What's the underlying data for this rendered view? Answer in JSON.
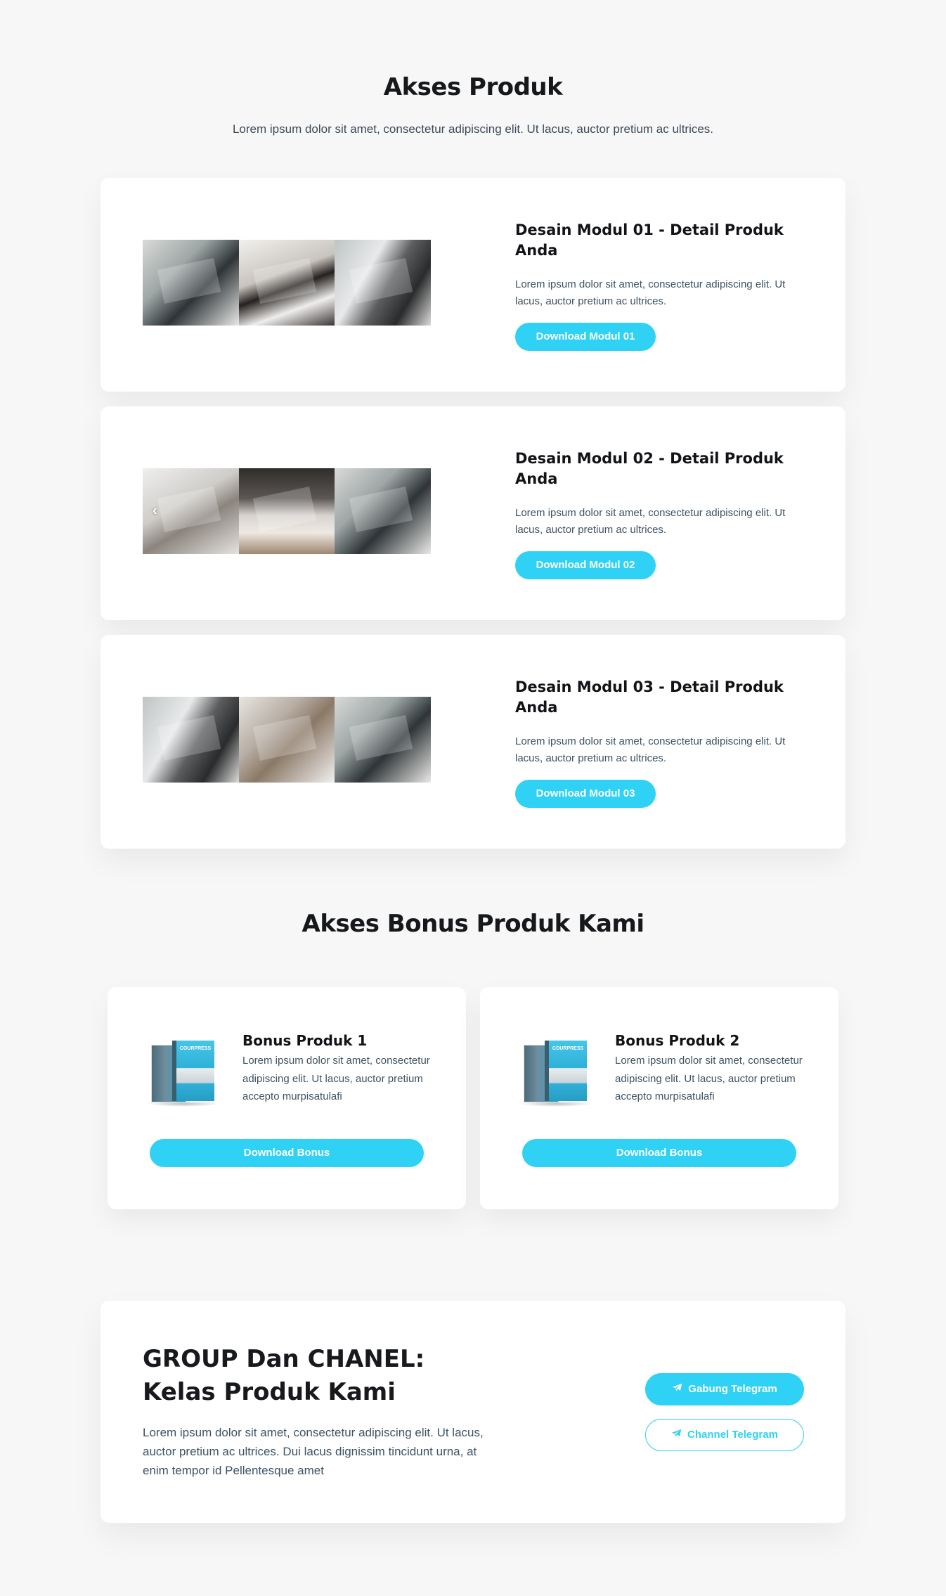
{
  "hero": {
    "title": "Akses Produk",
    "subtitle": "Lorem ipsum dolor sit amet, consectetur adipiscing elit. Ut lacus, auctor pretium ac ultrices."
  },
  "modules": [
    {
      "title": "Desain Modul 01 - Detail Produk Anda",
      "description": "Lorem ipsum dolor sit amet, consectetur adipiscing elit. Ut lacus, auctor pretium ac ultrices.",
      "button_label": "Download Modul 01"
    },
    {
      "title": "Desain Modul 02 - Detail Produk Anda",
      "description": "Lorem ipsum dolor sit amet, consectetur adipiscing elit. Ut lacus, auctor pretium ac ultrices.",
      "button_label": "Download Modul 02",
      "carousel_arrow": "‹"
    },
    {
      "title": "Desain Modul 03 - Detail Produk Anda",
      "description": "Lorem ipsum dolor sit amet, consectetur adipiscing elit. Ut lacus, auctor pretium ac ultrices.",
      "button_label": "Download Modul 03"
    }
  ],
  "bonus_section": {
    "title": "Akses Bonus Produk Kami",
    "items": [
      {
        "name": "Bonus Produk 1",
        "description": "Lorem ipsum dolor sit amet, consectetur adipiscing elit. Ut lacus, auctor pretium accepto murpisatulafi",
        "box_label": "COURPRESS",
        "button_label": "Download Bonus"
      },
      {
        "name": "Bonus Produk 2",
        "description": "Lorem ipsum dolor sit amet, consectetur adipiscing elit. Ut lacus, auctor pretium accepto murpisatulafi",
        "box_label": "COURPRESS",
        "button_label": "Download Bonus"
      }
    ]
  },
  "group": {
    "title_line1": "GROUP Dan CHANEL:",
    "title_line2": "Kelas Produk Kami",
    "description": "Lorem ipsum dolor sit amet, consectetur adipiscing elit. Ut lacus, auctor pretium ac ultrices. Dui lacus dignissim tincidunt urna, at enim tempor id Pellentesque amet",
    "join_button_label": "Gabung Telegram",
    "channel_button_label": "Channel Telegram",
    "icon": "telegram-icon"
  },
  "colors": {
    "accent": "#2fd1f4",
    "background": "#f7f7f8",
    "card": "#ffffff",
    "heading": "#16181c",
    "body_text": "#3e5363"
  }
}
